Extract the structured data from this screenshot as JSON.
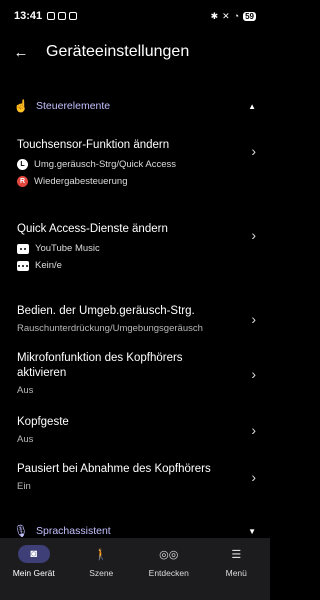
{
  "status": {
    "time": "13:41",
    "battery": "59"
  },
  "header": {
    "title": "Geräteeinstellungen"
  },
  "sections": {
    "controls": "Steuerelemente",
    "voice": "Sprachassistent"
  },
  "rows": [
    {
      "title": "Touchsensor-Funktion ändern",
      "items": [
        {
          "badge": "L",
          "text": "Umg.geräusch-Strg/Quick Access"
        },
        {
          "badge": "R",
          "text": "Wiedergabesteuerung"
        }
      ]
    },
    {
      "title": "Quick Access-Dienste ändern",
      "items": [
        {
          "text": "YouTube Music"
        },
        {
          "text": "Kein/e"
        }
      ]
    },
    {
      "title": "Bedien. der Umgeb.geräusch-Strg.",
      "sub": "Rauschunterdrückung/Umgebungsgeräusch"
    },
    {
      "title": "Mikrofonfunktion des Kopfhörers aktivieren",
      "sub": "Aus"
    },
    {
      "title": "Kopfgeste",
      "sub": "Aus"
    },
    {
      "title": "Pausiert bei Abnahme des Kopfhörers",
      "sub": "Ein"
    }
  ],
  "nav": [
    {
      "label": "Mein Gerät",
      "icon": "headphones-icon"
    },
    {
      "label": "Szene",
      "icon": "walking-person-icon"
    },
    {
      "label": "Entdecken",
      "icon": "binoculars-icon"
    },
    {
      "label": "Menü",
      "icon": "hamburger-menu-icon"
    }
  ]
}
